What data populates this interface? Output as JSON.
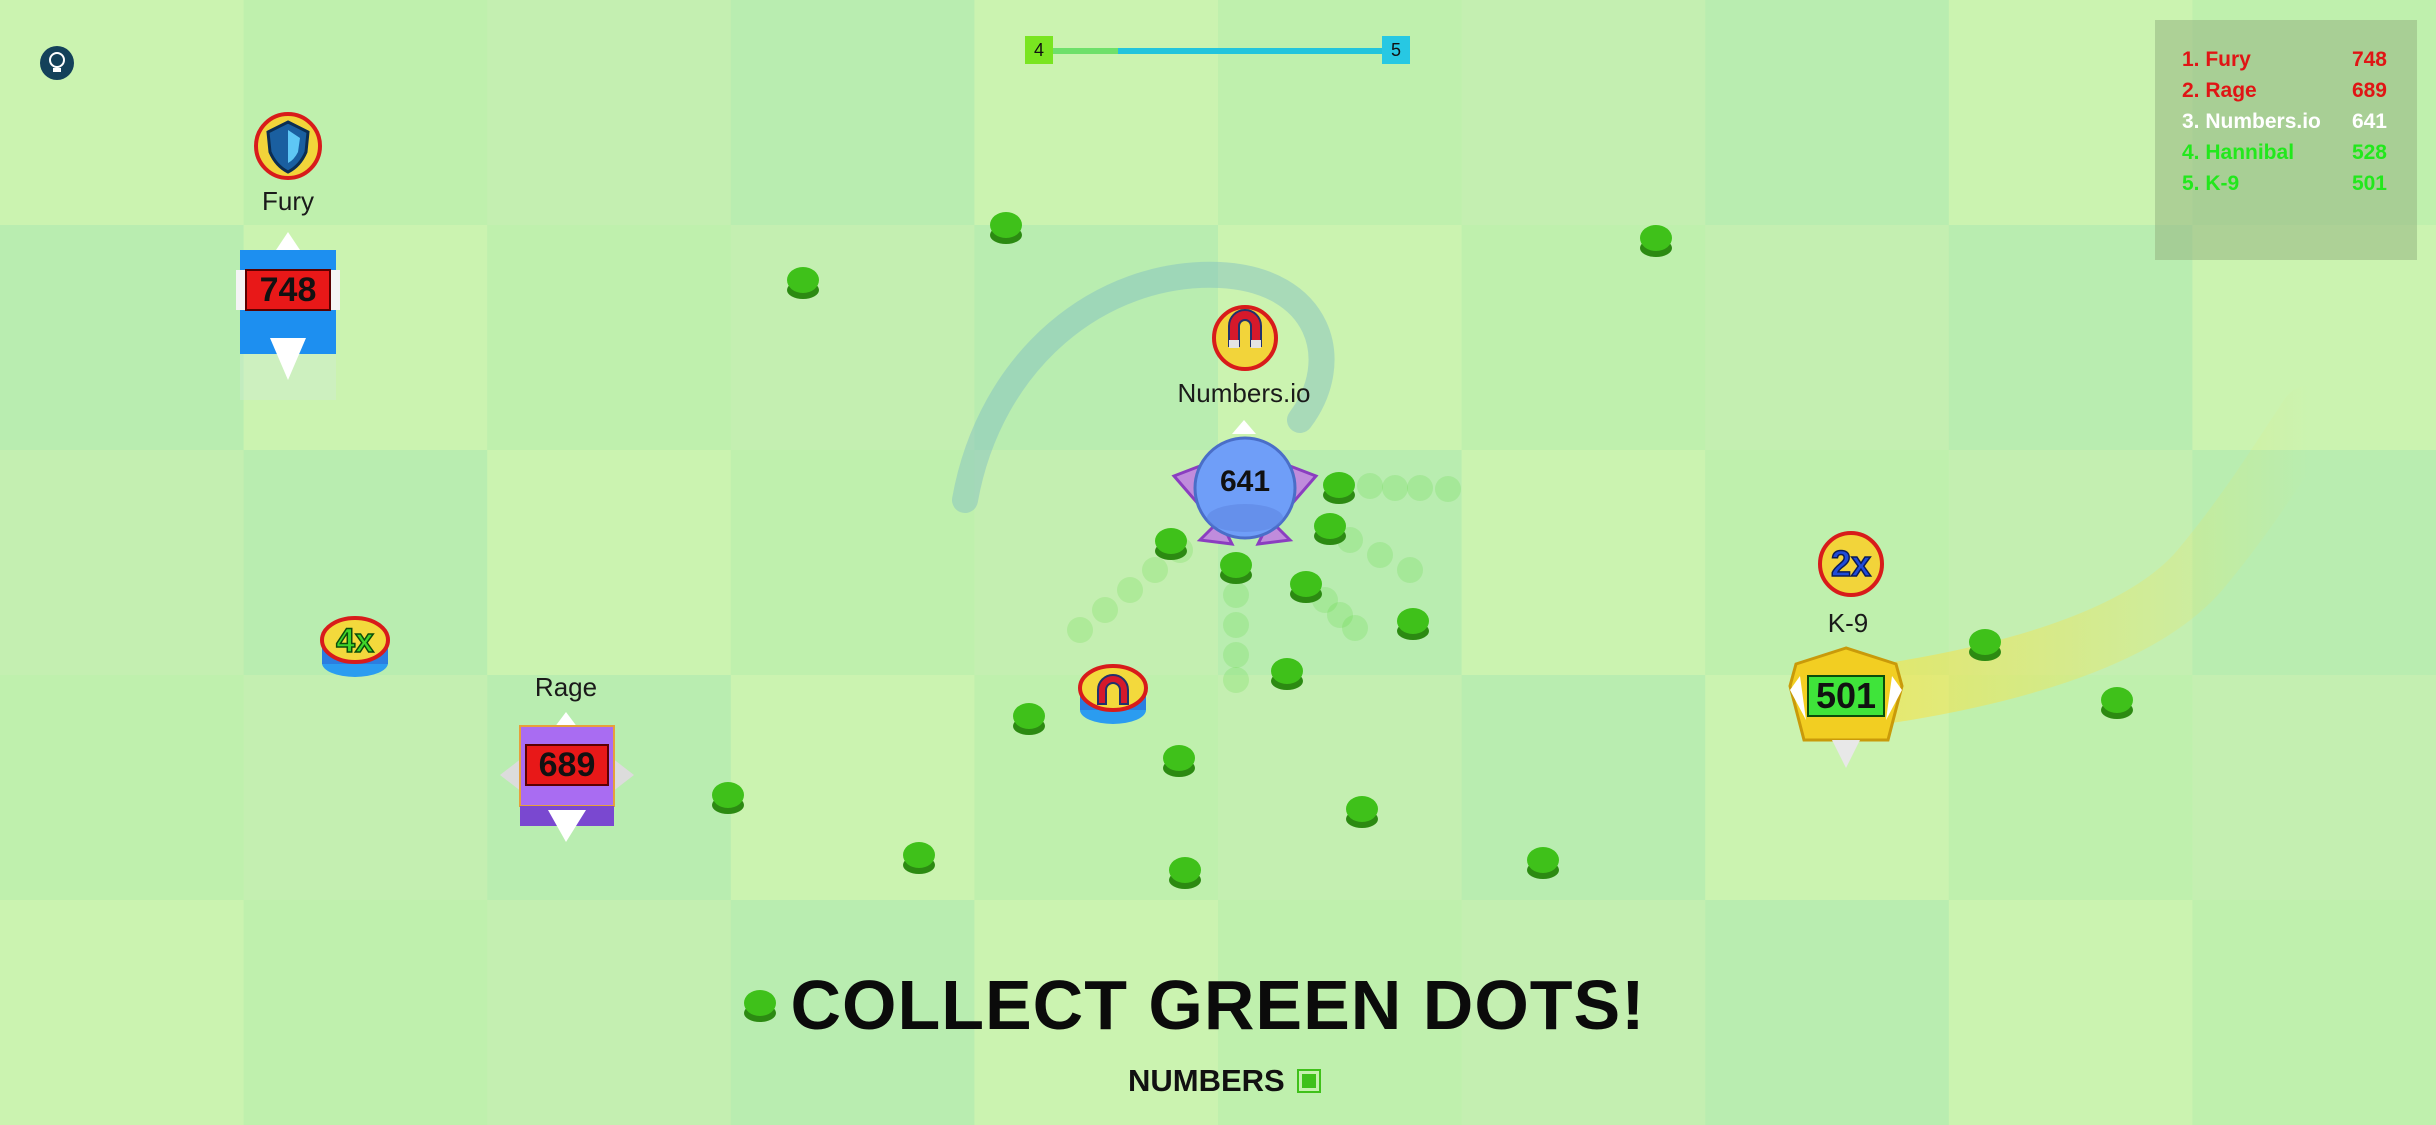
{
  "level": {
    "current": "4",
    "next": "5",
    "progress": 0.2
  },
  "leaderboard": [
    {
      "name": "1. Fury",
      "score": "748",
      "color": "#e01515"
    },
    {
      "name": "2. Rage",
      "score": "689",
      "color": "#e01515"
    },
    {
      "name": "3. Numbers.io",
      "score": "641",
      "color": "#ffffff"
    },
    {
      "name": "4. Hannibal",
      "score": "528",
      "color": "#22e81c"
    },
    {
      "name": "5. K-9",
      "score": "501",
      "color": "#22e81c"
    }
  ],
  "players": {
    "fury": {
      "name": "Fury",
      "score": "748",
      "powerup_icon": "shield-icon"
    },
    "rage": {
      "name": "Rage",
      "score": "689"
    },
    "numbers": {
      "name": "Numbers.io",
      "score": "641",
      "powerup_icon": "magnet-icon"
    },
    "k9": {
      "name": "K-9",
      "score": "501",
      "powerup": "2x"
    }
  },
  "pickups": {
    "multiplier_4x": "4x",
    "magnet": "magnet-icon"
  },
  "headline": "COLLECT GREEN DOTS!",
  "brand": "NUMBERS",
  "colors": {
    "dot": "#3fc11a",
    "background": "#c6f1ae",
    "headline": "#0b0b0b"
  }
}
